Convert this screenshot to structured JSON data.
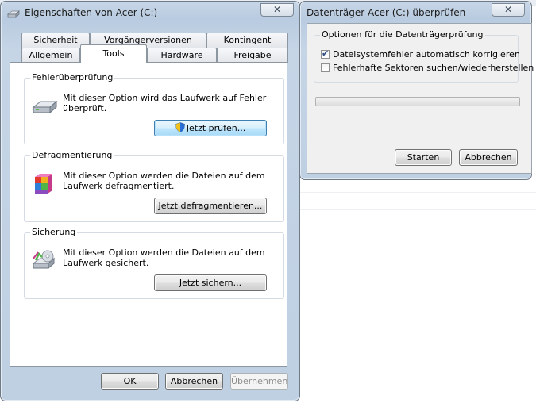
{
  "properties_window": {
    "title": "Eigenschaften von Acer (C:)",
    "close_glyph": "✕",
    "tabs_back": [
      "Sicherheit",
      "Vorgängerversionen",
      "Kontingent"
    ],
    "tabs_front": [
      "Allgemein",
      "Tools",
      "Hardware",
      "Freigabe"
    ],
    "active_tab": "Tools",
    "groups": {
      "error_check": {
        "label": "Fehlerüberprüfung",
        "text": "Mit dieser Option wird das Laufwerk auf Fehler überprüft.",
        "button": "Jetzt prüfen...",
        "icon": "drive-icon"
      },
      "defrag": {
        "label": "Defragmentierung",
        "text": "Mit dieser Option werden die Dateien auf dem Laufwerk defragmentiert.",
        "button": "Jetzt defragmentieren...",
        "icon": "defrag-icon"
      },
      "backup": {
        "label": "Sicherung",
        "text": "Mit dieser Option werden die Dateien auf dem Laufwerk gesichert.",
        "button": "Jetzt sichern...",
        "icon": "backup-icon"
      }
    },
    "buttons": {
      "ok": "OK",
      "cancel": "Abbrechen",
      "apply": "Übernehmen"
    }
  },
  "checkdisk_window": {
    "title": "Datenträger Acer (C:) überprüfen",
    "close_glyph": "✕",
    "group_label": "Optionen für die Datenträgerprüfung",
    "options": [
      {
        "label": "Dateisystemfehler automatisch korrigieren",
        "checked": true
      },
      {
        "label": "Fehlerhafte Sektoren suchen/wiederherstellen",
        "checked": false
      }
    ],
    "progress": 0,
    "buttons": {
      "start": "Starten",
      "cancel": "Abbrechen"
    }
  },
  "colors": {
    "frame": "#bfd0e3",
    "accent": "#3c7fb1",
    "shield_blue": "#2a6fd6",
    "shield_yellow": "#f2c21a"
  }
}
